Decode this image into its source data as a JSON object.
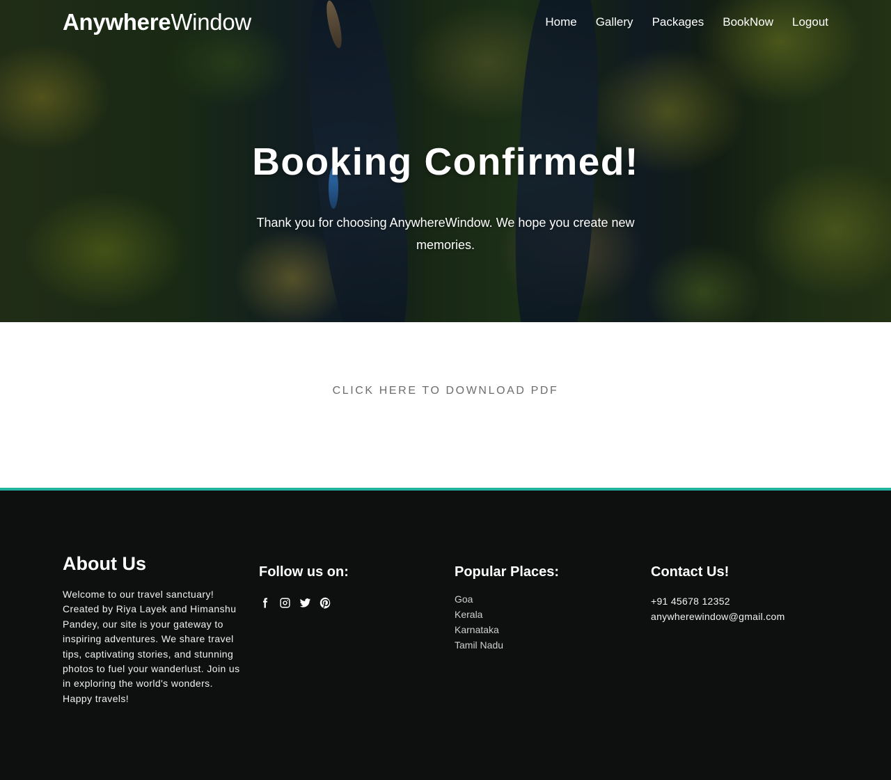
{
  "brand": {
    "name_bold": "Anywhere",
    "name_light": "Window"
  },
  "nav": {
    "items": [
      {
        "label": "Home"
      },
      {
        "label": "Gallery"
      },
      {
        "label": "Packages"
      },
      {
        "label": "BookNow"
      },
      {
        "label": "Logout"
      }
    ]
  },
  "hero": {
    "title": "Booking Confirmed!",
    "text": "Thank you for choosing AnywhereWindow. We hope you create new memories."
  },
  "download": {
    "label": "CLICK HERE TO DOWNLOAD PDF"
  },
  "footer": {
    "accent_color": "#21b3a0",
    "about": {
      "title_bold": "About",
      "title_light": " Us",
      "text": "Welcome to our travel sanctuary! Created by Riya Layek and Himanshu Pandey, our site is your gateway to inspiring adventures. We share travel tips, captivating stories, and stunning photos to fuel your wanderlust. Join us in exploring the world's wonders. Happy travels!"
    },
    "follow": {
      "title": "Follow us on:",
      "icons": [
        "facebook-icon",
        "instagram-icon",
        "twitter-icon",
        "pinterest-icon"
      ]
    },
    "places": {
      "title": "Popular Places:",
      "items": [
        "Goa",
        "Kerala",
        "Karnataka",
        "Tamil Nadu"
      ]
    },
    "contact": {
      "title": "Contact Us!",
      "phone": "+91 45678 12352",
      "email": "anywherewindow@gmail.com"
    }
  }
}
